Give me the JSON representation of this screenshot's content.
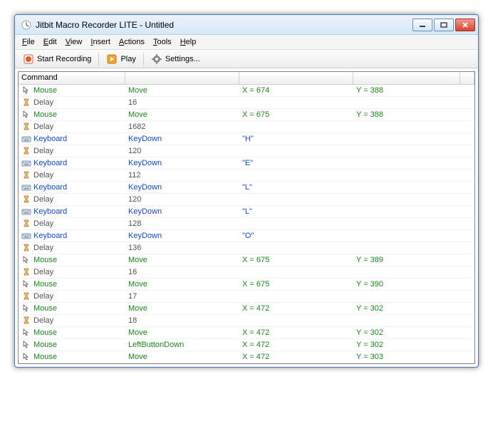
{
  "window": {
    "title": "Jitbit Macro Recorder LITE - Untitled"
  },
  "menubar": [
    {
      "label": "File",
      "u": 0
    },
    {
      "label": "Edit",
      "u": 0
    },
    {
      "label": "View",
      "u": 0
    },
    {
      "label": "Insert",
      "u": 0
    },
    {
      "label": "Actions",
      "u": 0
    },
    {
      "label": "Tools",
      "u": 0
    },
    {
      "label": "Help",
      "u": 0
    }
  ],
  "toolbar": {
    "record": "Start Recording",
    "play": "Play",
    "settings": "Settings..."
  },
  "grid": {
    "header": "Command",
    "rows": [
      {
        "type": "mouse",
        "cmd": "Mouse",
        "action": "Move",
        "p1": "X = 674",
        "p2": "Y = 388"
      },
      {
        "type": "delay",
        "cmd": "Delay",
        "action": "16",
        "p1": "",
        "p2": ""
      },
      {
        "type": "mouse",
        "cmd": "Mouse",
        "action": "Move",
        "p1": "X = 675",
        "p2": "Y = 388"
      },
      {
        "type": "delay",
        "cmd": "Delay",
        "action": "1682",
        "p1": "",
        "p2": ""
      },
      {
        "type": "keyboard",
        "cmd": "Keyboard",
        "action": "KeyDown",
        "p1": "\"H\"",
        "p2": ""
      },
      {
        "type": "delay",
        "cmd": "Delay",
        "action": "120",
        "p1": "",
        "p2": ""
      },
      {
        "type": "keyboard",
        "cmd": "Keyboard",
        "action": "KeyDown",
        "p1": "\"E\"",
        "p2": ""
      },
      {
        "type": "delay",
        "cmd": "Delay",
        "action": "112",
        "p1": "",
        "p2": ""
      },
      {
        "type": "keyboard",
        "cmd": "Keyboard",
        "action": "KeyDown",
        "p1": "\"L\"",
        "p2": ""
      },
      {
        "type": "delay",
        "cmd": "Delay",
        "action": "120",
        "p1": "",
        "p2": ""
      },
      {
        "type": "keyboard",
        "cmd": "Keyboard",
        "action": "KeyDown",
        "p1": "\"L\"",
        "p2": ""
      },
      {
        "type": "delay",
        "cmd": "Delay",
        "action": "128",
        "p1": "",
        "p2": ""
      },
      {
        "type": "keyboard",
        "cmd": "Keyboard",
        "action": "KeyDown",
        "p1": "\"O\"",
        "p2": ""
      },
      {
        "type": "delay",
        "cmd": "Delay",
        "action": "136",
        "p1": "",
        "p2": ""
      },
      {
        "type": "mouse",
        "cmd": "Mouse",
        "action": "Move",
        "p1": "X = 675",
        "p2": "Y = 389"
      },
      {
        "type": "delay",
        "cmd": "Delay",
        "action": "16",
        "p1": "",
        "p2": ""
      },
      {
        "type": "mouse",
        "cmd": "Mouse",
        "action": "Move",
        "p1": "X = 675",
        "p2": "Y = 390"
      },
      {
        "type": "delay",
        "cmd": "Delay",
        "action": "17",
        "p1": "",
        "p2": ""
      },
      {
        "type": "mouse",
        "cmd": "Mouse",
        "action": "Move",
        "p1": "X = 472",
        "p2": "Y = 302"
      },
      {
        "type": "delay",
        "cmd": "Delay",
        "action": "18",
        "p1": "",
        "p2": ""
      },
      {
        "type": "mouse",
        "cmd": "Mouse",
        "action": "Move",
        "p1": "X = 472",
        "p2": "Y = 302"
      },
      {
        "type": "mouse",
        "cmd": "Mouse",
        "action": "LeftButtonDown",
        "p1": "X = 472",
        "p2": "Y = 302"
      },
      {
        "type": "mouse",
        "cmd": "Mouse",
        "action": "Move",
        "p1": "X = 472",
        "p2": "Y = 303"
      }
    ]
  }
}
